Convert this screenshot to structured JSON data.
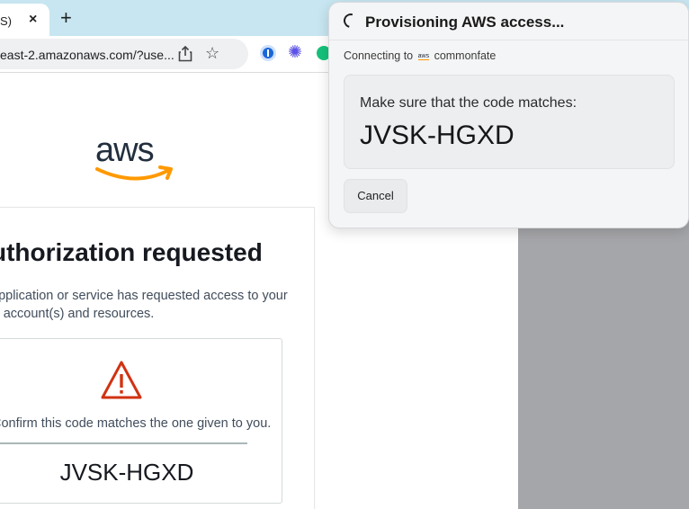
{
  "browser": {
    "tab_title": "S)",
    "tab_close": "×",
    "new_tab": "+",
    "url": "east-2.amazonaws.com/?use...",
    "icons": [
      "share-icon",
      "star-icon",
      "onepassword-icon",
      "puzzle-extension-icon",
      "grammarly-icon"
    ]
  },
  "aws_page": {
    "logo_text": "aws",
    "title": "uthorization requested",
    "description": "application or service has requested access to your S account(s) and resources.",
    "confirm_text": "Confirm this code matches the one given to you.",
    "code": "JVSK-HGXD"
  },
  "popup": {
    "title": "Provisioning AWS access...",
    "connecting_prefix": "Connecting to",
    "connecting_logo": "aws",
    "connecting_target": "commonfate",
    "match_label": "Make sure that the code matches:",
    "code": "JVSK-HGXD",
    "cancel_label": "Cancel"
  },
  "colors": {
    "tab_bar": "#c7e6f1",
    "aws_orange": "#ff9900",
    "aws_navy": "#232f3e",
    "warning_red": "#d13212",
    "page_backdrop": "#a5a6a9"
  }
}
